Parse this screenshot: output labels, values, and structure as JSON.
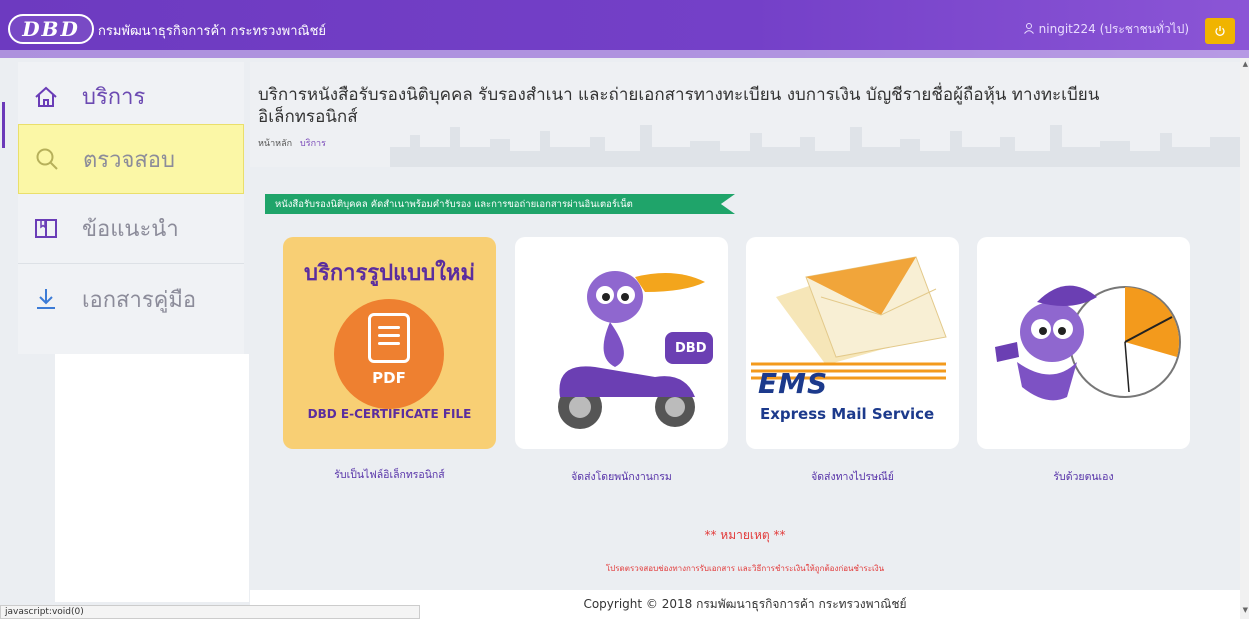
{
  "header": {
    "logo_text": "DBD",
    "org_name": "กรมพัฒนาธุรกิจการค้า กระทรวงพาณิชย์",
    "user_label": "ningit224 (ประชาชนทั่วไป)",
    "user_icon": "user-icon",
    "power_icon": "power-icon"
  },
  "sidebar": {
    "items": [
      {
        "label": "บริการ",
        "icon": "home-icon"
      },
      {
        "label": "ตรวจสอบ",
        "icon": "search-icon"
      },
      {
        "label": "ข้อแนะนำ",
        "icon": "book-icon"
      },
      {
        "label": "เอกสารคู่มือ",
        "icon": "download-icon"
      }
    ]
  },
  "main": {
    "title": "บริการหนังสือรับรองนิติบุคคล รับรองสำเนา และถ่ายเอกสารทางทะเบียน งบการเงิน บัญชีรายชื่อผู้ถือหุ้น ทางทะเบียน อิเล็กทรอนิกส์",
    "breadcrumb": {
      "home": "หน้าหลัก",
      "current": "บริการ"
    },
    "banner": "หนังสือรับรองนิติบุคคล คัดสำเนาพร้อมคำรับรอง และการขอถ่ายเอกสารผ่านอินเตอร์เน็ต",
    "cards": [
      {
        "label": "รับเป็นไฟล์อิเล็กทรอนิกส์",
        "title": "บริการรูปแบบใหม่",
        "badge": "PDF",
        "file_label": "DBD E-CERTIFICATE FILE"
      },
      {
        "label": "จัดส่งโดยพนักงานกรม",
        "badge": "DBD"
      },
      {
        "label": "จัดส่งทางไปรษณีย์",
        "brand": "EMS",
        "brand_sub": "Express Mail Service"
      },
      {
        "label": "รับด้วยตนเอง"
      }
    ],
    "note_title": "** หมายเหตุ **",
    "note_text": "โปรดตรวจสอบช่องทางการรับเอกสาร และวิธีการชำระเงินให้ถูกต้องก่อนชำระเงิน",
    "footer": "Copyright © 2018 กรมพัฒนาธุรกิจการค้า กระทรวงพาณิชย์"
  },
  "statusbar": "javascript:void(0)",
  "colors": {
    "header_purple": "#7440c8",
    "accent_green": "#1fa46a",
    "note_red": "#e23a3a",
    "highlight_yellow": "#fbf7a6",
    "power_button": "#f0b400"
  }
}
